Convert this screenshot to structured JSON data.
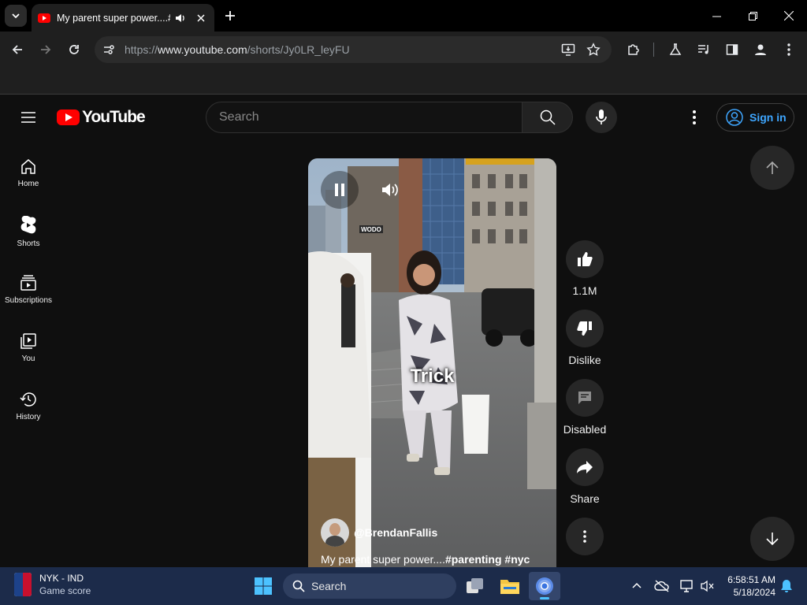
{
  "browser": {
    "tab": {
      "title": "My parent super power....#"
    },
    "url": {
      "prefix": "https://",
      "host": "www.youtube.com",
      "path": "/shorts/Jy0LR_leyFU"
    }
  },
  "youtube": {
    "logo_text": "YouTube",
    "search_placeholder": "Search",
    "sign_in_label": "Sign in",
    "guide": [
      {
        "label": "Home",
        "icon": "home-icon"
      },
      {
        "label": "Shorts",
        "icon": "shorts-icon"
      },
      {
        "label": "Subscriptions",
        "icon": "subscriptions-icon"
      },
      {
        "label": "You",
        "icon": "you-icon"
      },
      {
        "label": "History",
        "icon": "history-icon"
      }
    ],
    "short": {
      "caption": "Trick",
      "sign_text": "WODO",
      "channel_handle": "@BrendanFallis",
      "title_text": "My parent super power....",
      "hashtags": "#parenting #nyc"
    },
    "actions": {
      "like_count": "1.1M",
      "dislike_label": "Dislike",
      "comments_label": "Disabled",
      "share_label": "Share"
    }
  },
  "taskbar": {
    "widget": {
      "title": "NYK - IND",
      "subtitle": "Game score"
    },
    "search_label": "Search",
    "clock": {
      "time": "6:58:51 AM",
      "date": "5/18/2024"
    }
  },
  "colors": {
    "youtube_red": "#ff0000",
    "link_blue": "#3ea6ff",
    "page_background": "#0f0f0f",
    "taskbar": "#1c2b4a"
  }
}
